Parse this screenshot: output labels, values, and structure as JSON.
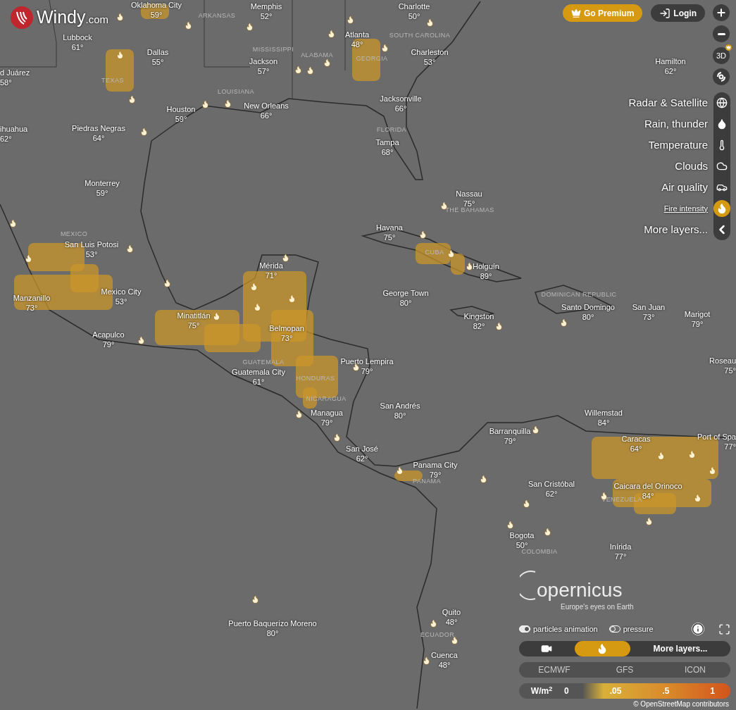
{
  "brand": {
    "name": "Windy",
    "suffix": ".com"
  },
  "account": {
    "premium": "Go Premium",
    "login": "Login"
  },
  "map_buttons": {
    "three_d": "3D"
  },
  "layers": [
    {
      "label": "Radar & Satellite",
      "kind": "globe",
      "selected": false
    },
    {
      "label": "Rain, thunder",
      "kind": "drop",
      "selected": false
    },
    {
      "label": "Temperature",
      "kind": "thermometer",
      "selected": false
    },
    {
      "label": "Clouds",
      "kind": "cloud",
      "selected": false
    },
    {
      "label": "Air quality",
      "kind": "car",
      "selected": false
    },
    {
      "label": "Fire intensity",
      "kind": "fire",
      "selected": true
    },
    {
      "label": "More layers...",
      "kind": "chevron",
      "selected": false
    }
  ],
  "cities": [
    {
      "name": "Oklahoma City",
      "temp": "59°"
    },
    {
      "name": "Memphis",
      "temp": "52°"
    },
    {
      "name": "Charlotte",
      "temp": "50°"
    },
    {
      "name": "Lubbock",
      "temp": "61°"
    },
    {
      "name": "Dallas",
      "temp": "55°"
    },
    {
      "name": "Atlanta",
      "temp": "48°"
    },
    {
      "name": "Charleston",
      "temp": "53°"
    },
    {
      "name": "Hamilton",
      "temp": "62°"
    },
    {
      "name": "d Juárez",
      "temp": "58°"
    },
    {
      "name": "Jackson",
      "temp": "57°"
    },
    {
      "name": "Houston",
      "temp": "59°"
    },
    {
      "name": "New Orleans",
      "temp": "66°"
    },
    {
      "name": "Jacksonville",
      "temp": "66°"
    },
    {
      "name": "ihuahua",
      "temp": "62°"
    },
    {
      "name": "Piedras Negras",
      "temp": "64°"
    },
    {
      "name": "Tampa",
      "temp": "68°"
    },
    {
      "name": "Monterrey",
      "temp": "59°"
    },
    {
      "name": "Nassau",
      "temp": "75°"
    },
    {
      "name": "San Luis Potosi",
      "temp": "53°"
    },
    {
      "name": "Havana",
      "temp": "75°"
    },
    {
      "name": "Mérida",
      "temp": "71°"
    },
    {
      "name": "Holguín",
      "temp": "89°"
    },
    {
      "name": "Mexico City",
      "temp": "53°"
    },
    {
      "name": "Manzanillo",
      "temp": "73°"
    },
    {
      "name": "George Town",
      "temp": "80°"
    },
    {
      "name": "Minatitlán",
      "temp": "75°"
    },
    {
      "name": "Kingston",
      "temp": "82°"
    },
    {
      "name": "Santo Domingo",
      "temp": "80°"
    },
    {
      "name": "San Juan",
      "temp": "73°"
    },
    {
      "name": "Marigot",
      "temp": "79°"
    },
    {
      "name": "Acapulco",
      "temp": "79°"
    },
    {
      "name": "Belmopan",
      "temp": "73°"
    },
    {
      "name": "Puerto Lempira",
      "temp": "79°"
    },
    {
      "name": "Roseau",
      "temp": "75°"
    },
    {
      "name": "Guatemala City",
      "temp": "61°"
    },
    {
      "name": "San Andrés",
      "temp": "80°"
    },
    {
      "name": "Managua",
      "temp": "79°"
    },
    {
      "name": "Willemstad",
      "temp": "84°"
    },
    {
      "name": "Barranquilla",
      "temp": "79°"
    },
    {
      "name": "Port of Spa",
      "temp": "77°"
    },
    {
      "name": "San José",
      "temp": "62°"
    },
    {
      "name": "Caracas",
      "temp": "64°"
    },
    {
      "name": "Panama City",
      "temp": "79°"
    },
    {
      "name": "San Cristóbal",
      "temp": "62°"
    },
    {
      "name": "Caicara del Orinoco",
      "temp": "84°"
    },
    {
      "name": "Bogota",
      "temp": "50°"
    },
    {
      "name": "Inírida",
      "temp": "77°"
    },
    {
      "name": "Quito",
      "temp": "48°"
    },
    {
      "name": "Puerto Baquerizo Moreno",
      "temp": "80°"
    },
    {
      "name": "Cuenca",
      "temp": "48°"
    }
  ],
  "regions": [
    {
      "name": "ARKANSAS"
    },
    {
      "name": "MISSISSIPPI"
    },
    {
      "name": "ALABAMA"
    },
    {
      "name": "GEORGIA"
    },
    {
      "name": "SOUTH CAROLINA"
    },
    {
      "name": "TEXAS"
    },
    {
      "name": "LOUISIANA"
    },
    {
      "name": "FLORIDA"
    },
    {
      "name": "THE BAHAMAS"
    },
    {
      "name": "MEXICO"
    },
    {
      "name": "CUBA"
    },
    {
      "name": "DOMINICAN REPUBLIC"
    },
    {
      "name": "GUATEMALA"
    },
    {
      "name": "HONDURAS"
    },
    {
      "name": "NICARAGUA"
    },
    {
      "name": "PANAMA"
    },
    {
      "name": "VENEZUELA"
    },
    {
      "name": "COLOMBIA"
    },
    {
      "name": "ECUADOR"
    }
  ],
  "partner": {
    "wordmark": "opernicus",
    "tagline": "Europe's eyes on Earth"
  },
  "toggles": [
    {
      "label": "particles animation",
      "on": true
    },
    {
      "label": "pressure",
      "on": false
    }
  ],
  "modes": [
    {
      "kind": "video",
      "selected": false
    },
    {
      "kind": "fire",
      "selected": true
    },
    {
      "kind": "text",
      "label": "More layers...",
      "selected": false
    }
  ],
  "models": [
    {
      "label": "ECMWF",
      "selected": false
    },
    {
      "label": "GFS",
      "selected": false
    },
    {
      "label": "ICON",
      "selected": false
    }
  ],
  "legend": {
    "unit": "W/m$^{2}$",
    "ticks": [
      "0",
      ".05",
      ".5",
      "1"
    ]
  },
  "attribution": "© OpenStreetMap contributors"
}
